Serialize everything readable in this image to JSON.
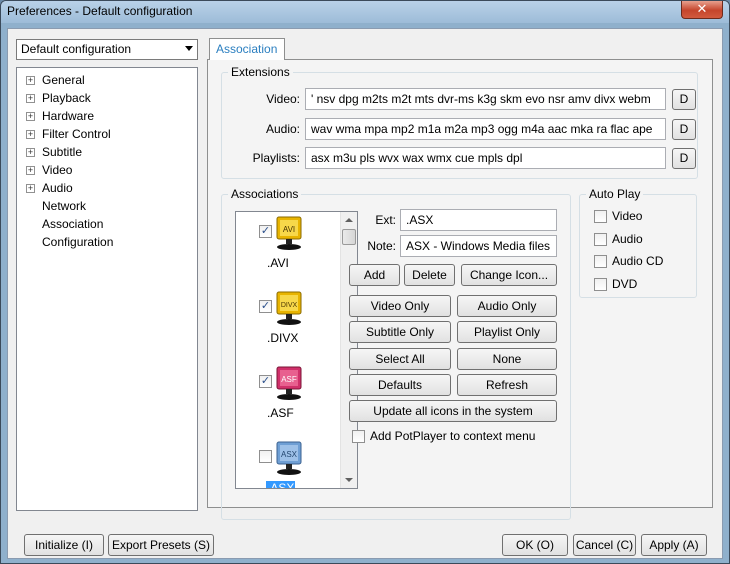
{
  "window": {
    "title": "Preferences - Default configuration",
    "close_glyph": "✕"
  },
  "preset": {
    "selected": "Default configuration"
  },
  "tree": [
    {
      "label": "General",
      "expander": "+"
    },
    {
      "label": "Playback",
      "expander": "+"
    },
    {
      "label": "Hardware",
      "expander": "+"
    },
    {
      "label": "Filter Control",
      "expander": "+"
    },
    {
      "label": "Subtitle",
      "expander": "+"
    },
    {
      "label": "Video",
      "expander": "+"
    },
    {
      "label": "Audio",
      "expander": "+"
    },
    {
      "label": "Network",
      "expander": ""
    },
    {
      "label": "Association",
      "expander": ""
    },
    {
      "label": "Configuration",
      "expander": ""
    }
  ],
  "tab": {
    "label": "Association"
  },
  "extensions": {
    "title": "Extensions",
    "video_label": "Video:",
    "video_value": "' nsv dpg m2ts m2t mts dvr-ms k3g skm evo nsr amv divx webm",
    "audio_label": "Audio:",
    "audio_value": "wav wma mpa mp2 m1a m2a mp3 ogg m4a aac mka ra flac ape",
    "playlists_label": "Playlists:",
    "playlists_value": "asx m3u pls wvx wax wmx cue mpls dpl",
    "default_button": "D"
  },
  "associations": {
    "title": "Associations",
    "check_glyph": "✓",
    "items": [
      {
        "label": ".AVI",
        "icon_text": "AVI",
        "checked": true,
        "color": "#e8b400"
      },
      {
        "label": ".DIVX",
        "icon_text": "DIVX",
        "checked": true,
        "color": "#e8b400"
      },
      {
        "label": ".ASF",
        "icon_text": "ASF",
        "checked": true,
        "color": "#d0306a"
      },
      {
        "label": ".ASX",
        "icon_text": "ASX",
        "checked": false,
        "color": "#6f9fd4"
      }
    ],
    "ext_label": "Ext:",
    "ext_value": ".ASX",
    "note_label": "Note:",
    "note_value": "ASX - Windows Media files",
    "add": "Add",
    "delete": "Delete",
    "change_icon": "Change Icon...",
    "video_only": "Video Only",
    "audio_only": "Audio Only",
    "subtitle_only": "Subtitle Only",
    "playlist_only": "Playlist Only",
    "select_all": "Select All",
    "none": "None",
    "defaults": "Defaults",
    "refresh": "Refresh",
    "update_icons": "Update all icons in the system",
    "context_menu": "Add PotPlayer to context menu"
  },
  "autoplay": {
    "title": "Auto Play",
    "options": [
      "Video",
      "Audio",
      "Audio CD",
      "DVD"
    ]
  },
  "footer": {
    "initialize": "Initialize (I)",
    "export": "Export Presets (S)",
    "ok": "OK (O)",
    "cancel": "Cancel (C)",
    "apply": "Apply (A)"
  },
  "colors": {
    "accent": "#2b7fc0",
    "selection": "#3399ff",
    "title_bar": "#9dbcd8"
  }
}
